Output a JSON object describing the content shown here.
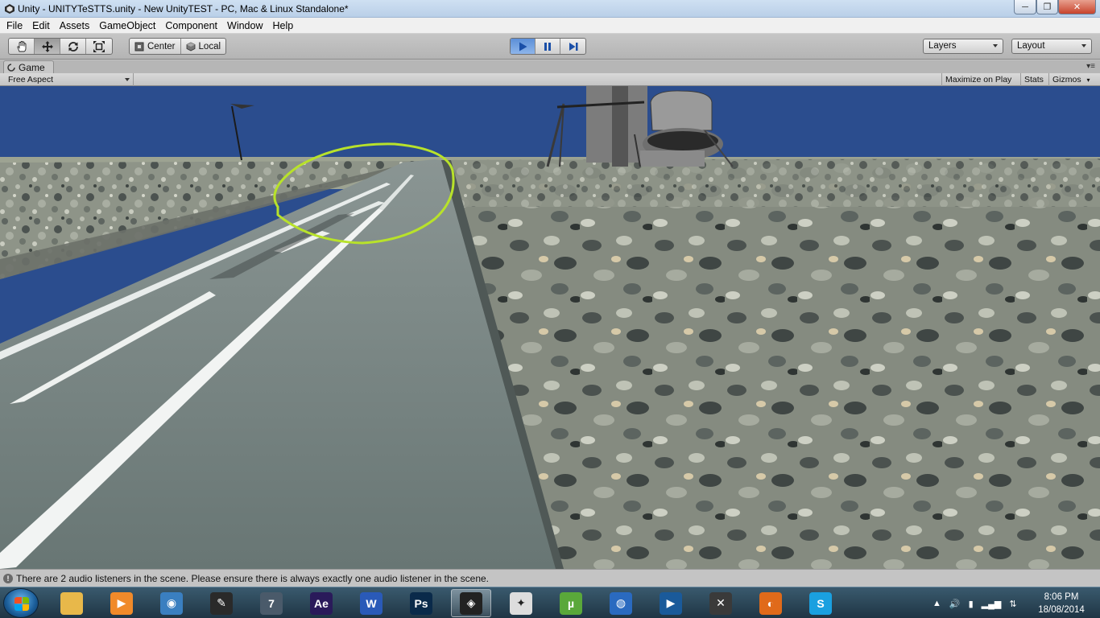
{
  "window": {
    "title": "Unity - UNITYTeSTTS.unity - New UnityTEST - PC, Mac & Linux Standalone*",
    "minimize_glyph": "─",
    "maximize_glyph": "❐",
    "close_glyph": "✕"
  },
  "menu": {
    "items": [
      "File",
      "Edit",
      "Assets",
      "GameObject",
      "Component",
      "Window",
      "Help"
    ]
  },
  "toolbar": {
    "tools": [
      "hand-icon",
      "move-icon",
      "rotate-icon",
      "scale-icon"
    ],
    "active_tool": "move-icon",
    "pivot_center_label": "Center",
    "pivot_local_label": "Local",
    "play_state": "playing",
    "layers_label": "Layers",
    "layout_label": "Layout"
  },
  "game_panel": {
    "tab_label": "Game",
    "aspect_label": "Free Aspect",
    "maximize_label": "Maximize on Play",
    "stats_label": "Stats",
    "gizmos_label": "Gizmos"
  },
  "scene": {
    "sky_color": "#2b4d8e",
    "ground_color": "#8e9488",
    "road_color": "#6f7d7a",
    "highlight_circle_color": "#b8e22a"
  },
  "status": {
    "message": "There are 2 audio listeners in the scene. Please ensure there is always exactly one audio listener in the scene."
  },
  "taskbar": {
    "apps": [
      {
        "name": "file-explorer-icon",
        "glyph": "",
        "color": "#e8b84a"
      },
      {
        "name": "media-player-icon",
        "glyph": "▶",
        "color": "#f08a2a"
      },
      {
        "name": "camera-app-icon",
        "glyph": "◉",
        "color": "#3a7fc0"
      },
      {
        "name": "feather-app-icon",
        "glyph": "✎",
        "color": "#2a2a2a"
      },
      {
        "name": "seven-app-icon",
        "glyph": "7",
        "color": "#4a5a6a"
      },
      {
        "name": "after-effects-icon",
        "glyph": "Ae",
        "color": "#2a1a5a"
      },
      {
        "name": "word-icon",
        "glyph": "W",
        "color": "#2a5ab8"
      },
      {
        "name": "photoshop-icon",
        "glyph": "Ps",
        "color": "#0a2a4a"
      },
      {
        "name": "unity-icon",
        "glyph": "◈",
        "color": "#222222"
      },
      {
        "name": "zbrush-icon",
        "glyph": "✦",
        "color": "#dddddd"
      },
      {
        "name": "utorrent-icon",
        "glyph": "µ",
        "color": "#5aa83a"
      },
      {
        "name": "google-earth-icon",
        "glyph": "◍",
        "color": "#2a6ac0"
      },
      {
        "name": "video-player-icon",
        "glyph": "▶",
        "color": "#1a5a9a"
      },
      {
        "name": "network-tool-icon",
        "glyph": "✕",
        "color": "#3a3a3a"
      },
      {
        "name": "firefox-icon",
        "glyph": "◐",
        "color": "#e06a1a"
      },
      {
        "name": "skype-icon",
        "glyph": "S",
        "color": "#1aa0e0"
      }
    ],
    "active_app": "unity-icon",
    "clock_time": "8:06 PM",
    "clock_date": "18/08/2014"
  }
}
